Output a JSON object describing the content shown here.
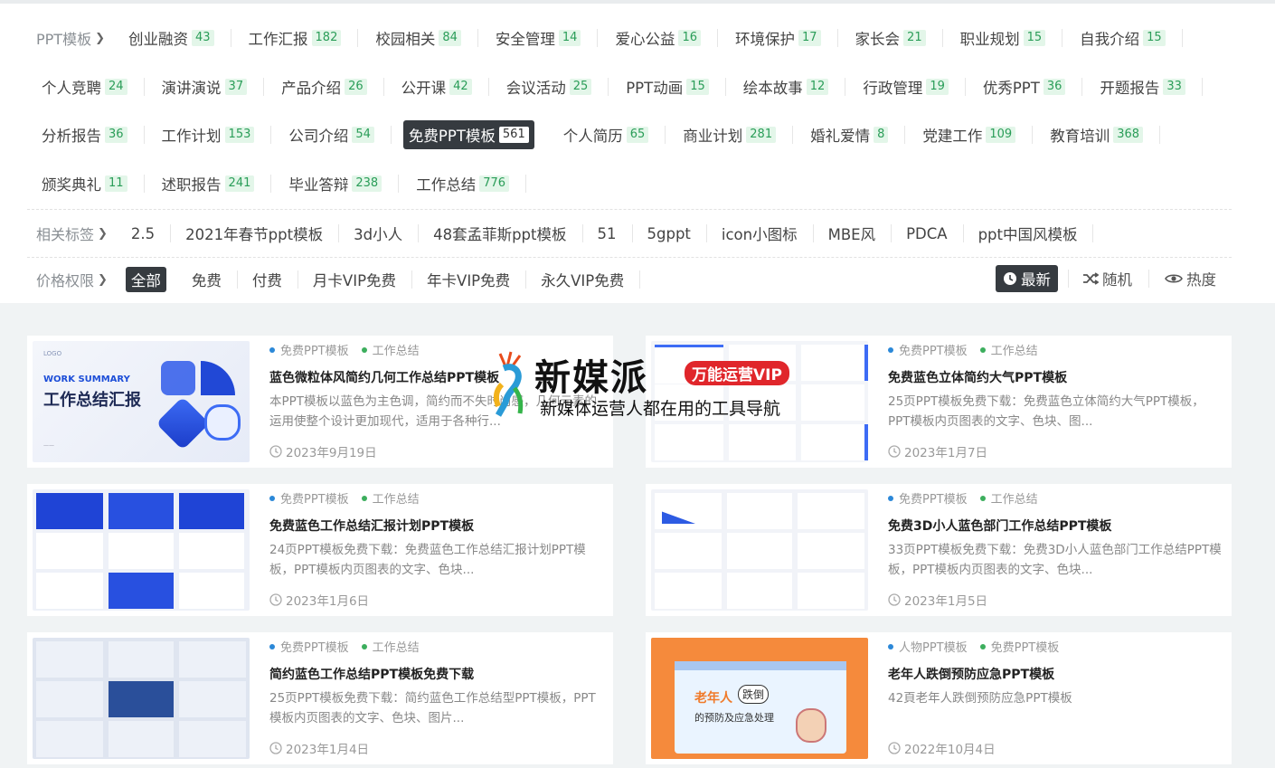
{
  "categories": {
    "label": "PPT模板",
    "rows": [
      [
        {
          "name": "创业融资",
          "count": "43"
        },
        {
          "name": "工作汇报",
          "count": "182"
        },
        {
          "name": "校园相关",
          "count": "84"
        },
        {
          "name": "安全管理",
          "count": "14"
        },
        {
          "name": "爱心公益",
          "count": "16"
        },
        {
          "name": "环境保护",
          "count": "17"
        },
        {
          "name": "家长会",
          "count": "21"
        },
        {
          "name": "职业规划",
          "count": "15"
        },
        {
          "name": "自我介绍",
          "count": "15"
        }
      ],
      [
        {
          "name": "个人竞聘",
          "count": "24"
        },
        {
          "name": "演讲演说",
          "count": "37"
        },
        {
          "name": "产品介绍",
          "count": "26"
        },
        {
          "name": "公开课",
          "count": "42"
        },
        {
          "name": "会议活动",
          "count": "25"
        },
        {
          "name": "PPT动画",
          "count": "15"
        },
        {
          "name": "绘本故事",
          "count": "12"
        },
        {
          "name": "行政管理",
          "count": "19"
        },
        {
          "name": "优秀PPT",
          "count": "36"
        },
        {
          "name": "开题报告",
          "count": "33"
        }
      ],
      [
        {
          "name": "分析报告",
          "count": "36"
        },
        {
          "name": "工作计划",
          "count": "153"
        },
        {
          "name": "公司介绍",
          "count": "54"
        },
        {
          "name": "免费PPT模板",
          "count": "561",
          "active": true
        },
        {
          "name": "个人简历",
          "count": "65"
        },
        {
          "name": "商业计划",
          "count": "281"
        },
        {
          "name": "婚礼爱情",
          "count": "8"
        },
        {
          "name": "党建工作",
          "count": "109"
        },
        {
          "name": "教育培训",
          "count": "368"
        }
      ],
      [
        {
          "name": "颁奖典礼",
          "count": "11"
        },
        {
          "name": "述职报告",
          "count": "241"
        },
        {
          "name": "毕业答辩",
          "count": "238"
        },
        {
          "name": "工作总结",
          "count": "776"
        }
      ]
    ]
  },
  "related_tags": {
    "label": "相关标签",
    "items": [
      "2.5",
      "2021年春节ppt模板",
      "3d小人",
      "48套孟菲斯ppt模板",
      "51",
      "5gppt",
      "icon小图标",
      "MBE风",
      "PDCA",
      "ppt中国风模板"
    ]
  },
  "price": {
    "label": "价格权限",
    "items": [
      {
        "name": "全部",
        "active": true
      },
      {
        "name": "免费"
      },
      {
        "name": "付费"
      },
      {
        "name": "月卡VIP免费"
      },
      {
        "name": "年卡VIP免费"
      },
      {
        "name": "永久VIP免费"
      }
    ]
  },
  "sort": {
    "latest": "最新",
    "random": "随机",
    "hot": "热度"
  },
  "watermark": {
    "brand": "新媒派",
    "badge": "万能运营VIP",
    "slogan": "新媒体运营人都在用的工具导航"
  },
  "cards": [
    {
      "tag1": "免费PPT模板",
      "tag2": "工作总结",
      "title": "蓝色微粒体风简约几何工作总结PPT模板",
      "desc": "本PPT模板以蓝色为主色调，简约而不失时尚感，几何元素的运用使整个设计更加现代，适用于各种行...",
      "date": "2023年9月19日",
      "thumb_text": "工作总结汇报",
      "thumb_sub": "WORK SUMMARY",
      "thumb_logo": "LOGO"
    },
    {
      "tag1": "免费PPT模板",
      "tag2": "工作总结",
      "title": "免费蓝色立体简约大气PPT模板",
      "desc": "25页PPT模板免费下载：免费蓝色立体简约大气PPT模板，PPT模板内页图表的文字、色块、图...",
      "date": "2023年1月7日"
    },
    {
      "tag1": "免费PPT模板",
      "tag2": "工作总结",
      "title": "免费蓝色工作总结汇报计划PPT模板",
      "desc": "24页PPT模板免费下载：免费蓝色工作总结汇报计划PPT模板，PPT模板内页图表的文字、色块...",
      "date": "2023年1月6日"
    },
    {
      "tag1": "免费PPT模板",
      "tag2": "工作总结",
      "title": "免费3D小人蓝色部门工作总结PPT模板",
      "desc": "33页PPT模板免费下载：免费3D小人蓝色部门工作总结PPT模板，PPT模板内页图表的文字、色块...",
      "date": "2023年1月5日"
    },
    {
      "tag1": "免费PPT模板",
      "tag2": "工作总结",
      "title": "简约蓝色工作总结PPT模板免费下载",
      "desc": "25页PPT模板免费下载：简约蓝色工作总结型PPT模板，PPT模板内页图表的文字、色块、图片...",
      "date": "2023年1月4日"
    },
    {
      "tag1": "人物PPT模板",
      "tag2": "免费PPT模板",
      "title": "老年人跌倒预防应急PPT模板",
      "desc": "42頁老年人跌倒预防应急PPT模板",
      "date": "2022年10月4日",
      "thumb_text": "老年人",
      "thumb_text2": "跌倒",
      "thumb_sub": "的预防及应急处理"
    }
  ]
}
